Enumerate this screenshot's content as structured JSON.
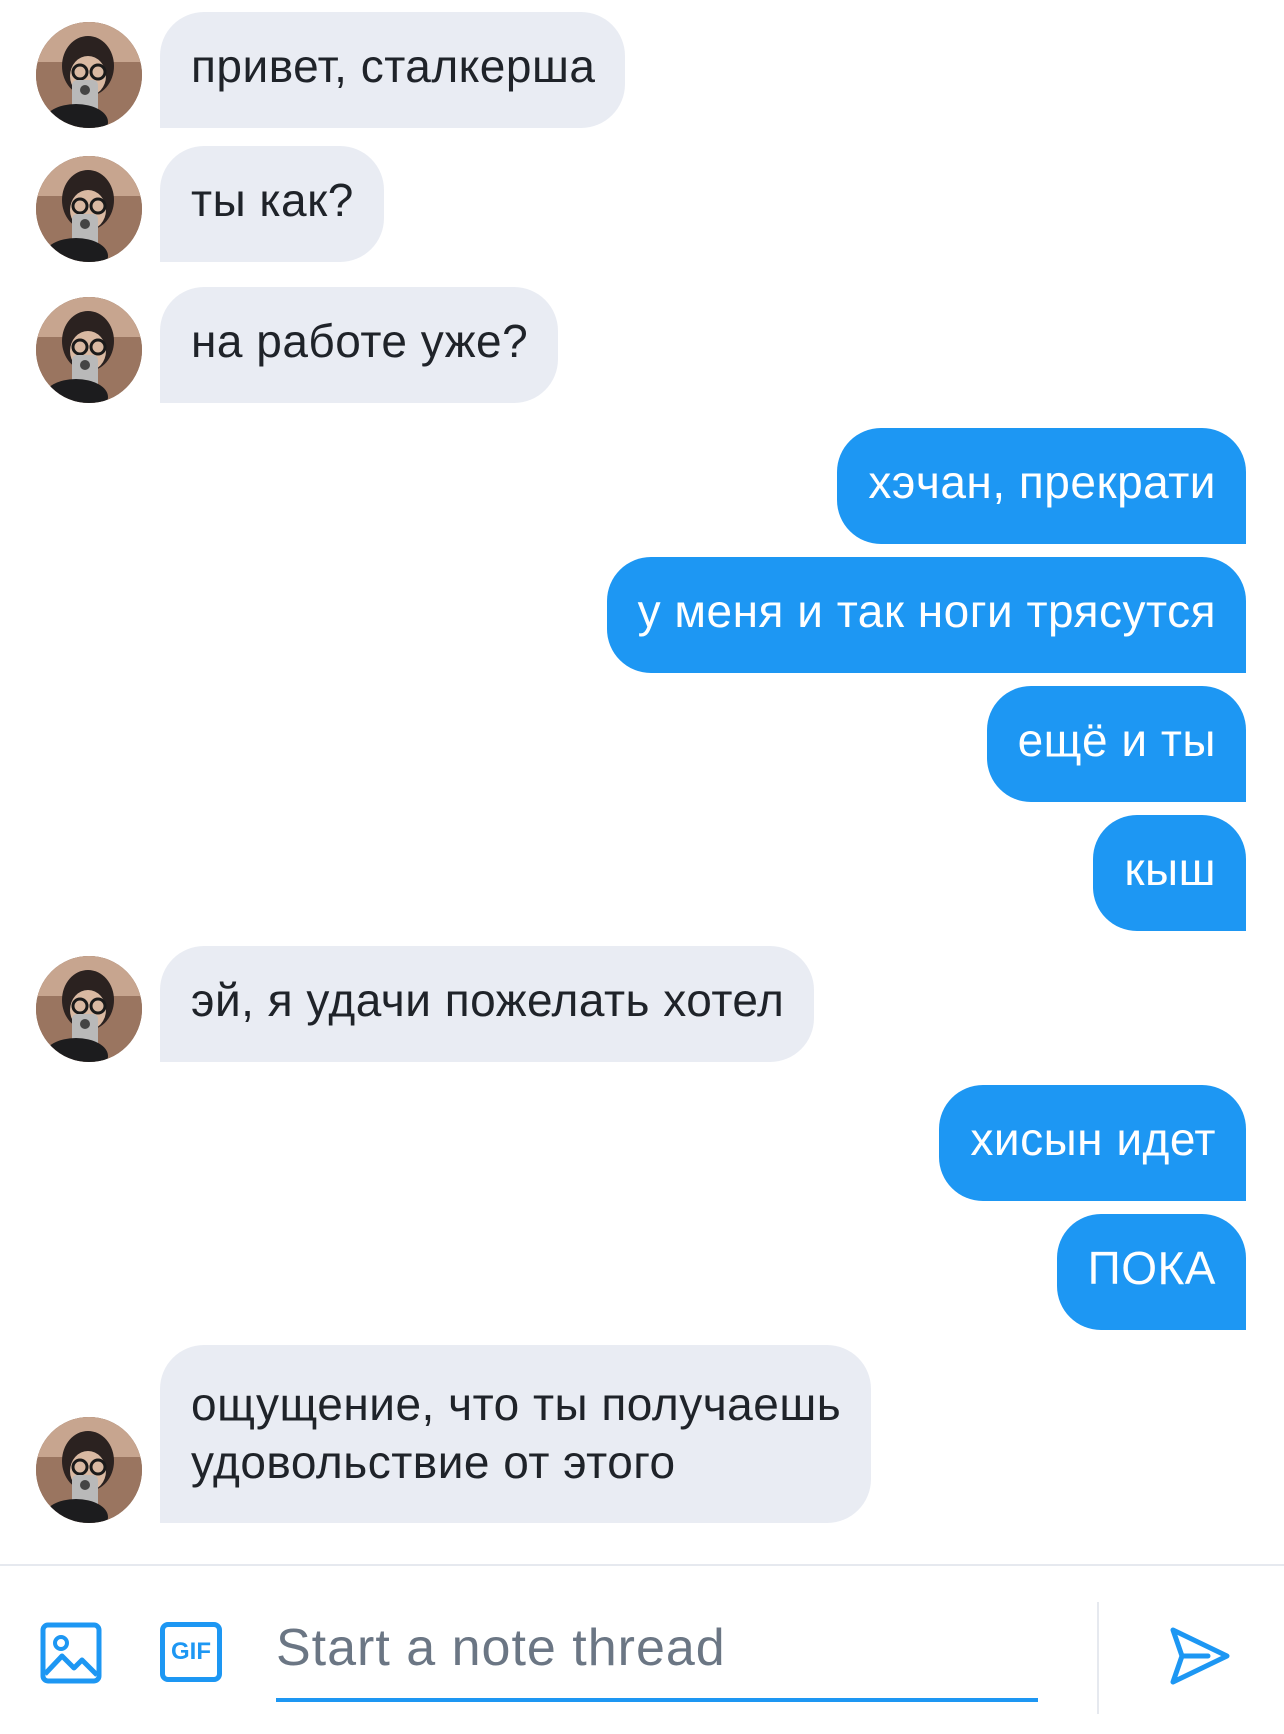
{
  "messages": [
    {
      "side": "in",
      "text": "привет, сталкерша"
    },
    {
      "side": "in",
      "text": "ты как?"
    },
    {
      "side": "in",
      "text": "на работе уже?"
    },
    {
      "side": "out",
      "text": "хэчан, прекрати"
    },
    {
      "side": "out",
      "text": "у меня и так ноги трясутся"
    },
    {
      "side": "out",
      "text": "ещё и ты"
    },
    {
      "side": "out",
      "text": "кыш"
    },
    {
      "side": "in",
      "text": "эй, я удачи пожелать хотел"
    },
    {
      "side": "out",
      "text": "хисын идет"
    },
    {
      "side": "out",
      "text": "ПОКА"
    },
    {
      "side": "in",
      "lines": [
        "ощущение, что ты получаешь",
        "удовольствие от этого"
      ]
    }
  ],
  "composer": {
    "placeholder": "Start a note thread",
    "value": "",
    "image_icon": "image-icon",
    "gif_label": "GIF",
    "send_icon": "send-icon"
  },
  "colors": {
    "outgoing_bubble": "#1d97f3",
    "incoming_bubble": "#e9ecf3",
    "accent": "#1d97f3"
  }
}
